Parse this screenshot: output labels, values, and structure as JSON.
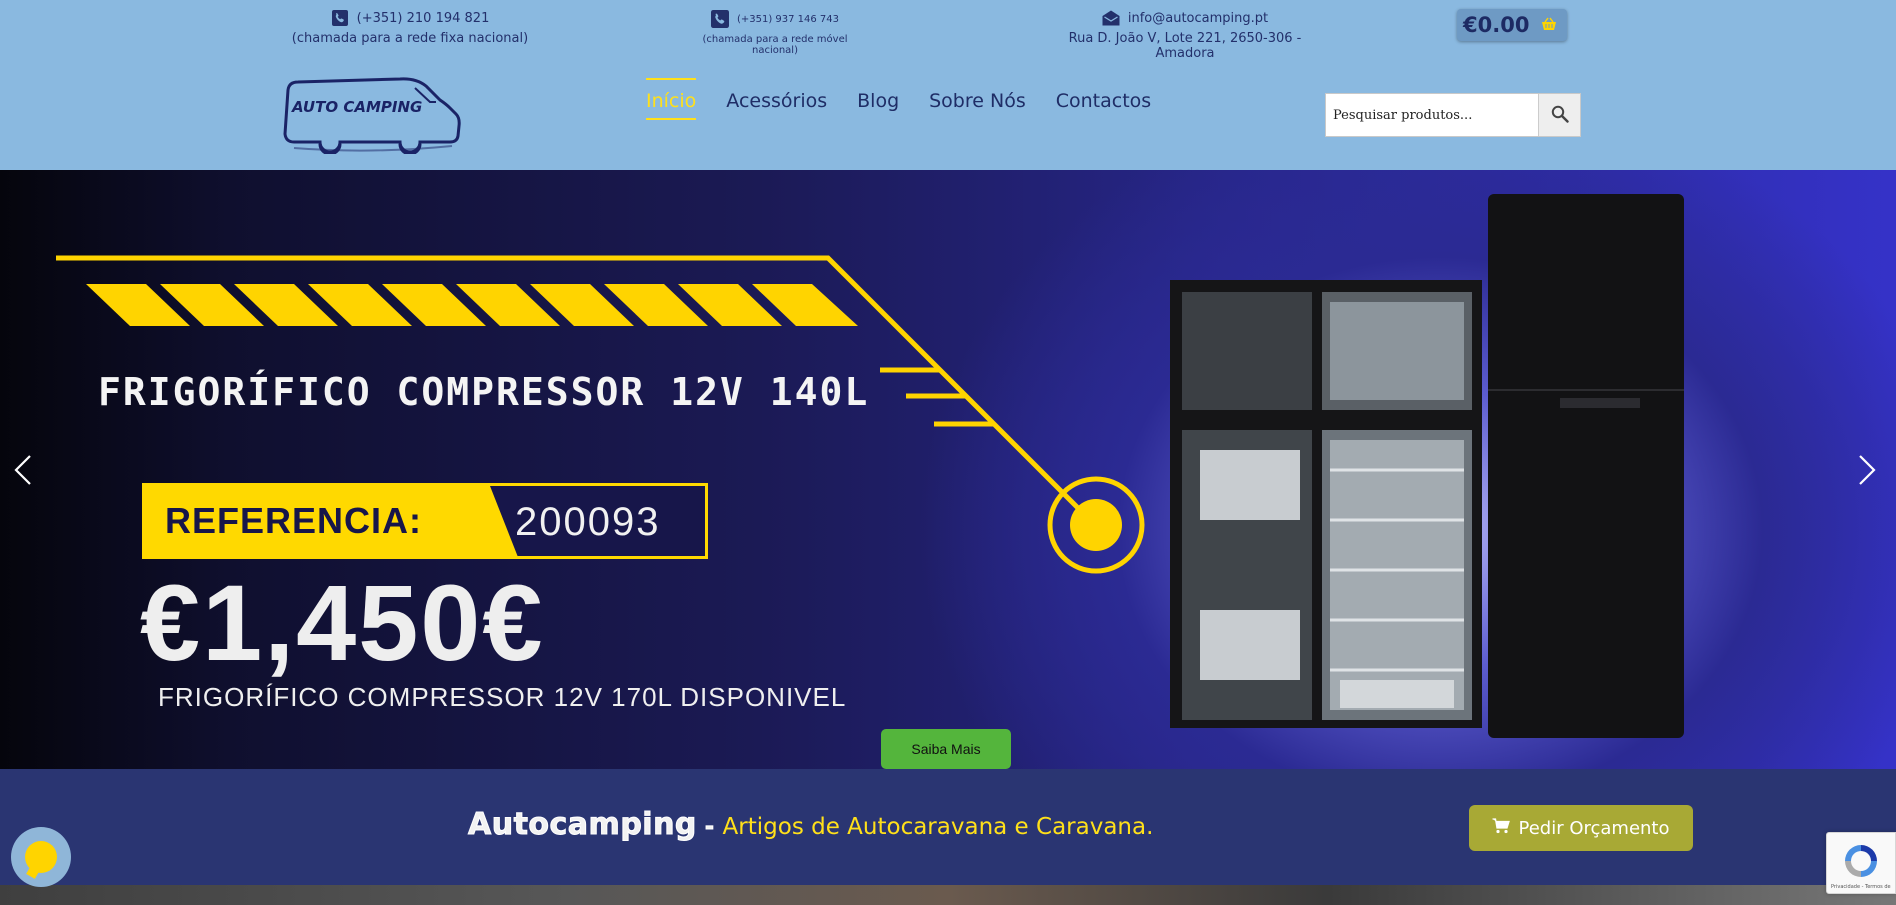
{
  "contacts": [
    {
      "icon": "phone-icon",
      "line1": "(+351) 210 194 821",
      "line2": "(chamada para a rede fixa nacional)"
    },
    {
      "icon": "phone-icon",
      "line1": "(+351) 937 146 743",
      "line2": "(chamada para a rede móvel nacional)"
    },
    {
      "icon": "envelope-icon",
      "line1": "info@autocamping.pt",
      "line2": "Rua D. João V, Lote 221, 2650-306 - Amadora"
    }
  ],
  "cart": {
    "amount": "€0.00",
    "icon": "basket-icon"
  },
  "logo": {
    "text": "AUTO CAMPING"
  },
  "nav": {
    "items": [
      {
        "label": "Início",
        "active": true
      },
      {
        "label": "Acessórios"
      },
      {
        "label": "Blog"
      },
      {
        "label": "Sobre Nós"
      },
      {
        "label": "Contactos"
      }
    ]
  },
  "search": {
    "placeholder": "Pesquisar produtos...",
    "icon": "search-icon"
  },
  "hero": {
    "title": "FRIGORÍFICO COMPRESSOR 12V 140L",
    "reference_label": "REFERENCIA:",
    "reference_value": "200093",
    "price": "€1,450€",
    "subtitle": "FRIGORÍFICO COMPRESSOR 12V 170L DISPONIVEL",
    "cta": "Saiba Mais"
  },
  "band": {
    "brand": "Autocamping",
    "separator": "-",
    "tagline": "Artigos de Autocaravana e Caravana.",
    "cta": "Pedir Orçamento"
  },
  "recaptcha": {
    "links": "Privacidade - Termos de"
  },
  "colors": {
    "accent_yellow": "#ffe01a",
    "navy": "#1f2d66",
    "header_bg": "#8ab9e0",
    "band_bg": "#2a3572",
    "cta_green": "#54b53c",
    "quote_olive": "#a8a935"
  }
}
